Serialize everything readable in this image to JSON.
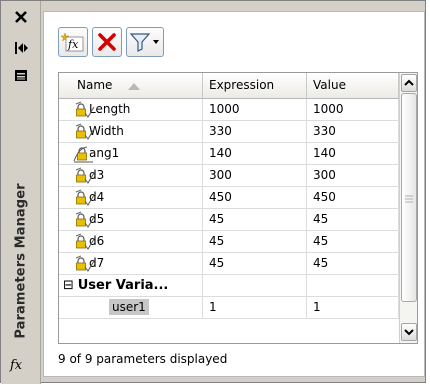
{
  "panel": {
    "title": "Parameters Manager",
    "side_fx": "fx"
  },
  "titlebar_icons": [
    "close-icon",
    "auto-hide-icon",
    "properties-icon"
  ],
  "toolbar": {
    "buttons": [
      "new-user-parameter-icon",
      "delete-icon",
      "filter-icon"
    ]
  },
  "grid": {
    "headers": {
      "name": "Name",
      "expression": "Expression",
      "value": "Value"
    },
    "rows": [
      {
        "name": "Length",
        "expression": "1000",
        "value": "1000",
        "icon": "linear-constraint-lock-icon"
      },
      {
        "name": "Width",
        "expression": "330",
        "value": "330",
        "icon": "linear-constraint-lock-icon"
      },
      {
        "name": "ang1",
        "expression": "140",
        "value": "140",
        "icon": "angular-constraint-lock-icon"
      },
      {
        "name": "d3",
        "expression": "300",
        "value": "300",
        "icon": "linear-constraint-lock-icon"
      },
      {
        "name": "d4",
        "expression": "450",
        "value": "450",
        "icon": "linear-constraint-lock-icon"
      },
      {
        "name": "d5",
        "expression": "45",
        "value": "45",
        "icon": "linear-constraint-lock-icon"
      },
      {
        "name": "d6",
        "expression": "45",
        "value": "45",
        "icon": "linear-constraint-lock-icon"
      },
      {
        "name": "d7",
        "expression": "45",
        "value": "45",
        "icon": "linear-constraint-lock-icon"
      }
    ],
    "group": {
      "label": "User Varia...",
      "expanded_glyph": "⊟"
    },
    "user_rows": [
      {
        "name": "user1",
        "expression": "1",
        "value": "1"
      }
    ]
  },
  "status": "9 of 9 parameters displayed",
  "colors": {
    "panel_bg": "#d4d0c8",
    "selection": "#c7c7c7",
    "lock_yellow": "#e8c000",
    "delete_red": "#d40000"
  }
}
